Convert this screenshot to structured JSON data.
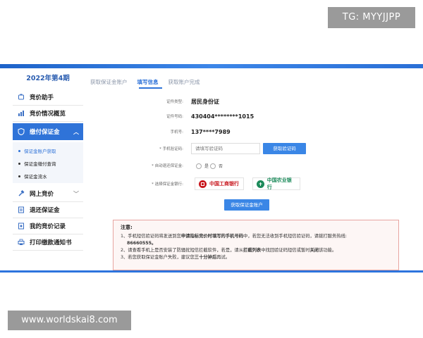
{
  "watermarks": {
    "top": "TG: MYYJJPP",
    "bottom": "www.worldskai8.com"
  },
  "sidebar": {
    "period": "2022年第4期",
    "items": [
      {
        "label": "竞价助手",
        "icon": "assistant-icon"
      },
      {
        "label": "竞价情况概览",
        "icon": "chart-icon"
      },
      {
        "label": "缴付保证金",
        "icon": "shield-icon"
      },
      {
        "label": "网上竞价",
        "icon": "bid-icon"
      },
      {
        "label": "退还保证金",
        "icon": "refund-icon"
      },
      {
        "label": "我的竞价记录",
        "icon": "record-icon"
      },
      {
        "label": "打印缴款通知书",
        "icon": "print-icon"
      }
    ],
    "sub_items": [
      {
        "label": "保证金账户获取"
      },
      {
        "label": "保证金缴付查询"
      },
      {
        "label": "保证金流水"
      }
    ]
  },
  "steps": [
    "获取保证金账户",
    "填写信息",
    "获取账户完成"
  ],
  "form": {
    "id_type_label": "证件类型:",
    "id_type_value": "居民身份证",
    "id_number_label": "证件号码:",
    "id_number_value": "430404********1015",
    "phone_label": "手机号:",
    "phone_value": "137****7989",
    "sms_label": "* 手机验证码:",
    "sms_placeholder": "请填写验证码",
    "sms_button": "获取验证码",
    "auto_refund_label": "* 自动退还保证金:",
    "radio_yes": "是",
    "radio_no": "否",
    "bank_label": "* 选择保证金银行:",
    "bank_icbc": "中国工商银行",
    "bank_abc": "中国农业银行",
    "submit_button": "获取保证金账户"
  },
  "notice": {
    "title": "注意:",
    "line1_a": "1、手机短信验证码将发送到您",
    "line1_b": "申请指标竞价时填写的手机号码",
    "line1_c": "中，若您无法收到手机短信验证码，请拨打服务热线:",
    "line1_d": "86660555。",
    "line2_a": "2、请查看手机上是否安装了防骚扰短信拦截软件，若是，请从",
    "line2_b": "拦截列表",
    "line2_c": "中找回验证码短信或暂时",
    "line2_d": "关闭",
    "line2_e": "该功能。",
    "line3_a": "3、若您获取保证金账户失败，建议您",
    "line3_b": "三十分钟后",
    "line3_c": "再试。"
  },
  "colors": {
    "accent": "#2f73d8",
    "button": "#3a86e6",
    "notice_border": "#e7a5a0",
    "icbc": "#c8161d",
    "abc": "#1b8a5a"
  }
}
